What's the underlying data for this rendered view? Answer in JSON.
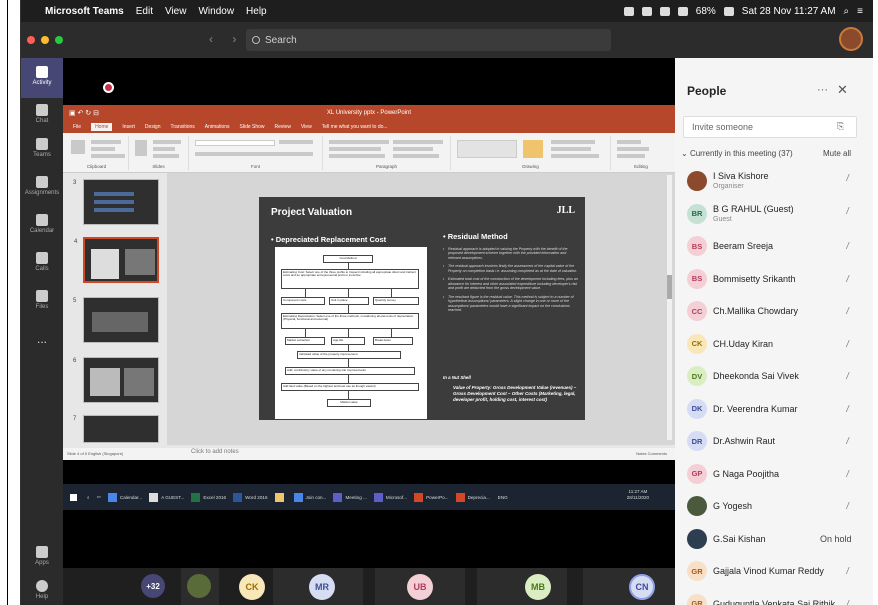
{
  "menubar": {
    "apple": "",
    "app": "Microsoft Teams",
    "items": [
      "Edit",
      "View",
      "Window",
      "Help"
    ],
    "battery": "68%",
    "datetime": "Sat 28 Nov 11:27 AM"
  },
  "teams": {
    "search_placeholder": "Search",
    "nav_arrows": "‹ ›"
  },
  "rail": [
    {
      "label": "Activity"
    },
    {
      "label": "Chat"
    },
    {
      "label": "Teams"
    },
    {
      "label": "Assignments"
    },
    {
      "label": "Calendar"
    },
    {
      "label": "Calls"
    },
    {
      "label": "Files"
    },
    {
      "label": "..."
    },
    {
      "label": "Apps"
    },
    {
      "label": "Help"
    }
  ],
  "ppt": {
    "title": "XL University pptx - PowerPoint",
    "tabs": [
      "File",
      "Home",
      "Insert",
      "Design",
      "Transitions",
      "Animations",
      "Slide Show",
      "Review",
      "View",
      "Tell me what you want to do..."
    ],
    "ribbon_groups": [
      "Clipboard",
      "Slides",
      "Font",
      "Paragraph",
      "Drawing",
      "Editing"
    ],
    "thumb_numbers": [
      "3",
      "4",
      "5",
      "6",
      "7"
    ],
    "notes": "Click to add notes",
    "status_left": "Slide 4 of 5    English (Singapore)",
    "status_right": "Notes    Comments",
    "slide": {
      "title": "Project Valuation",
      "logo": "JLL",
      "left_heading": "Depreciated Replacement Cost",
      "right_heading": "Residual Method",
      "diagram": {
        "top": "Cost Method",
        "desc": "Estimating Cost: Select one of the three profile to Inspect including all appropriate direct and indirect costs and an appropriate entrepreneurial profit or incentive",
        "row1": [
          "Component costs",
          "Unit in place",
          "Quantity survey"
        ],
        "desc2": "Estimating Depreciation: Select one of the three methods, considering all elements of depreciation (Physical, functional and external)",
        "row2": [
          "Market extraction",
          "Age-life",
          "Break down"
        ],
        "mid": "Indicated value of the property improvement",
        "row3": "Add: contributory value of any remaining site improvements",
        "row4": "Add land value (Based on the highest and best use as though vacant)",
        "bottom": "Market value"
      },
      "bullets": [
        "Residual approach is adopted in valuing the Property with the benefit of the proposed development scheme together with the provided information and relevant assumptions.",
        "The residual approach involves firstly the assessment of the capital value of the Property on completion basis i.e. assuming completed as at the date of valuation.",
        "Estimated total cost of the construction of the development including fees, plus an allowance for interest and other associated expenditure including developer's risk and profit are deducted from the gross development value.",
        "The resultant figure is the residual value. This method is subject to a number of hypothetical assumptions/ parameters. A slight change in one or more of the assumptions/ parameters would have a significant impact on the conclusions reached."
      ],
      "nutshell_label": "In a Nut Shell",
      "nutshell_text": "Value of Property: Gross Development Value (revenues) – Gross Development Cost – Other Costs (Marketing, legal, developer profit, holding cost, interest cost)"
    }
  },
  "taskbar": {
    "items": [
      "Calendar...",
      "A GUEST...",
      "Excel 2016",
      "Word 2016",
      "",
      "Join con...",
      "Meeting ...",
      "Microsof...",
      "PowerPo...",
      "Deprecia..."
    ],
    "time": "11:27 AM",
    "date": "28/11/2020",
    "lang": "ENG"
  },
  "strip": {
    "overflow": "+32",
    "avatars": [
      "CK",
      "MR",
      "UB",
      "MB",
      "CN"
    ]
  },
  "people": {
    "title": "People",
    "more": "···",
    "close": "✕",
    "invite_placeholder": "Invite someone",
    "section": "Currently in this meeting (37)",
    "mute_all": "Mute all",
    "on_hold": "On hold",
    "list": [
      {
        "initials": "",
        "name": "I Siva Kishore",
        "role": "Organiser",
        "color": "#8b4a2b",
        "fg": "#fff"
      },
      {
        "initials": "BR",
        "name": "B G RAHUL (Guest)",
        "role": "Guest",
        "color": "#c7e0d4",
        "fg": "#1e6b4b"
      },
      {
        "initials": "BS",
        "name": "Beeram Sreeja",
        "role": "",
        "color": "#f4cfd6",
        "fg": "#b33d5a"
      },
      {
        "initials": "BS",
        "name": "Bommisetty Srikanth",
        "role": "",
        "color": "#f4cfd6",
        "fg": "#b33d5a"
      },
      {
        "initials": "CC",
        "name": "Ch.Mallika Chowdary",
        "role": "",
        "color": "#f4cfd6",
        "fg": "#b33d5a"
      },
      {
        "initials": "CK",
        "name": "CH.Uday Kiran",
        "role": "",
        "color": "#f8e7b8",
        "fg": "#9a6f00"
      },
      {
        "initials": "DV",
        "name": "Dheekonda Sai Vivek",
        "role": "",
        "color": "#dbedc3",
        "fg": "#4a7a1c"
      },
      {
        "initials": "DK",
        "name": "Dr. Veerendra Kumar",
        "role": "",
        "color": "#d6dcf2",
        "fg": "#3f4c9c"
      },
      {
        "initials": "DR",
        "name": "Dr.Ashwin Raut",
        "role": "",
        "color": "#d6dcf2",
        "fg": "#3f4c9c"
      },
      {
        "initials": "GP",
        "name": "G Naga Poojitha",
        "role": "",
        "color": "#f4cfd6",
        "fg": "#b33d5a"
      },
      {
        "initials": "",
        "name": "G Yogesh",
        "role": "",
        "color": "#4b5a3c",
        "fg": "#fff"
      },
      {
        "initials": "",
        "name": "G.Sai Kishan",
        "role": "",
        "color": "#2c3e50",
        "fg": "#fff",
        "hold": true
      },
      {
        "initials": "GR",
        "name": "Gajjala Vinod Kumar Reddy",
        "role": "",
        "color": "#f8e0c8",
        "fg": "#a35a14"
      },
      {
        "initials": "GR",
        "name": "Guduguntla Venkata Sai Rithik",
        "role": "",
        "color": "#f8e0c8",
        "fg": "#a35a14"
      }
    ]
  }
}
